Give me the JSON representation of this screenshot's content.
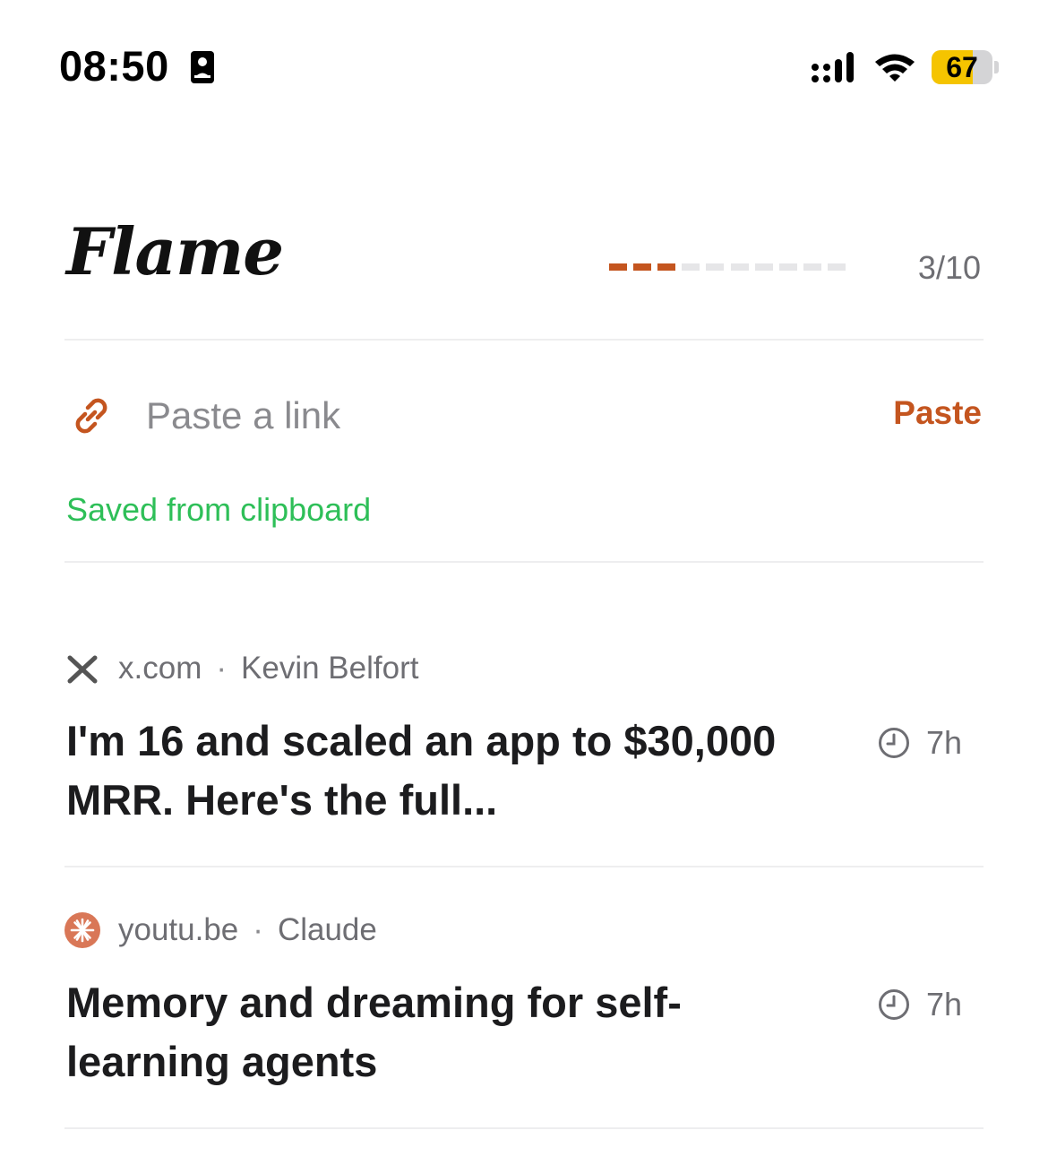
{
  "status_bar": {
    "time": "08:50",
    "battery_percent": "67",
    "battery_level": 0.67
  },
  "header": {
    "title": "Flame",
    "progress_current": 3,
    "progress_total": 10,
    "progress_label": "3/10"
  },
  "paste": {
    "placeholder": "Paste a link",
    "button_label": "Paste",
    "status": "Saved from clipboard"
  },
  "colors": {
    "accent": "#c4551f",
    "success": "#2ebf58",
    "battery": "#f5c400"
  },
  "feed": {
    "items": [
      {
        "source_icon": "x-logo-icon",
        "domain": "x.com",
        "separator": "·",
        "author": "Kevin Belfort",
        "title": "I'm 16 and scaled an app to $30,000 MRR. Here's the full...",
        "age": "7h"
      },
      {
        "source_icon": "claude-logo-icon",
        "domain": "youtu.be",
        "separator": "·",
        "author": "Claude",
        "title": "Memory and dreaming for self-learning agents",
        "age": "7h"
      }
    ]
  }
}
